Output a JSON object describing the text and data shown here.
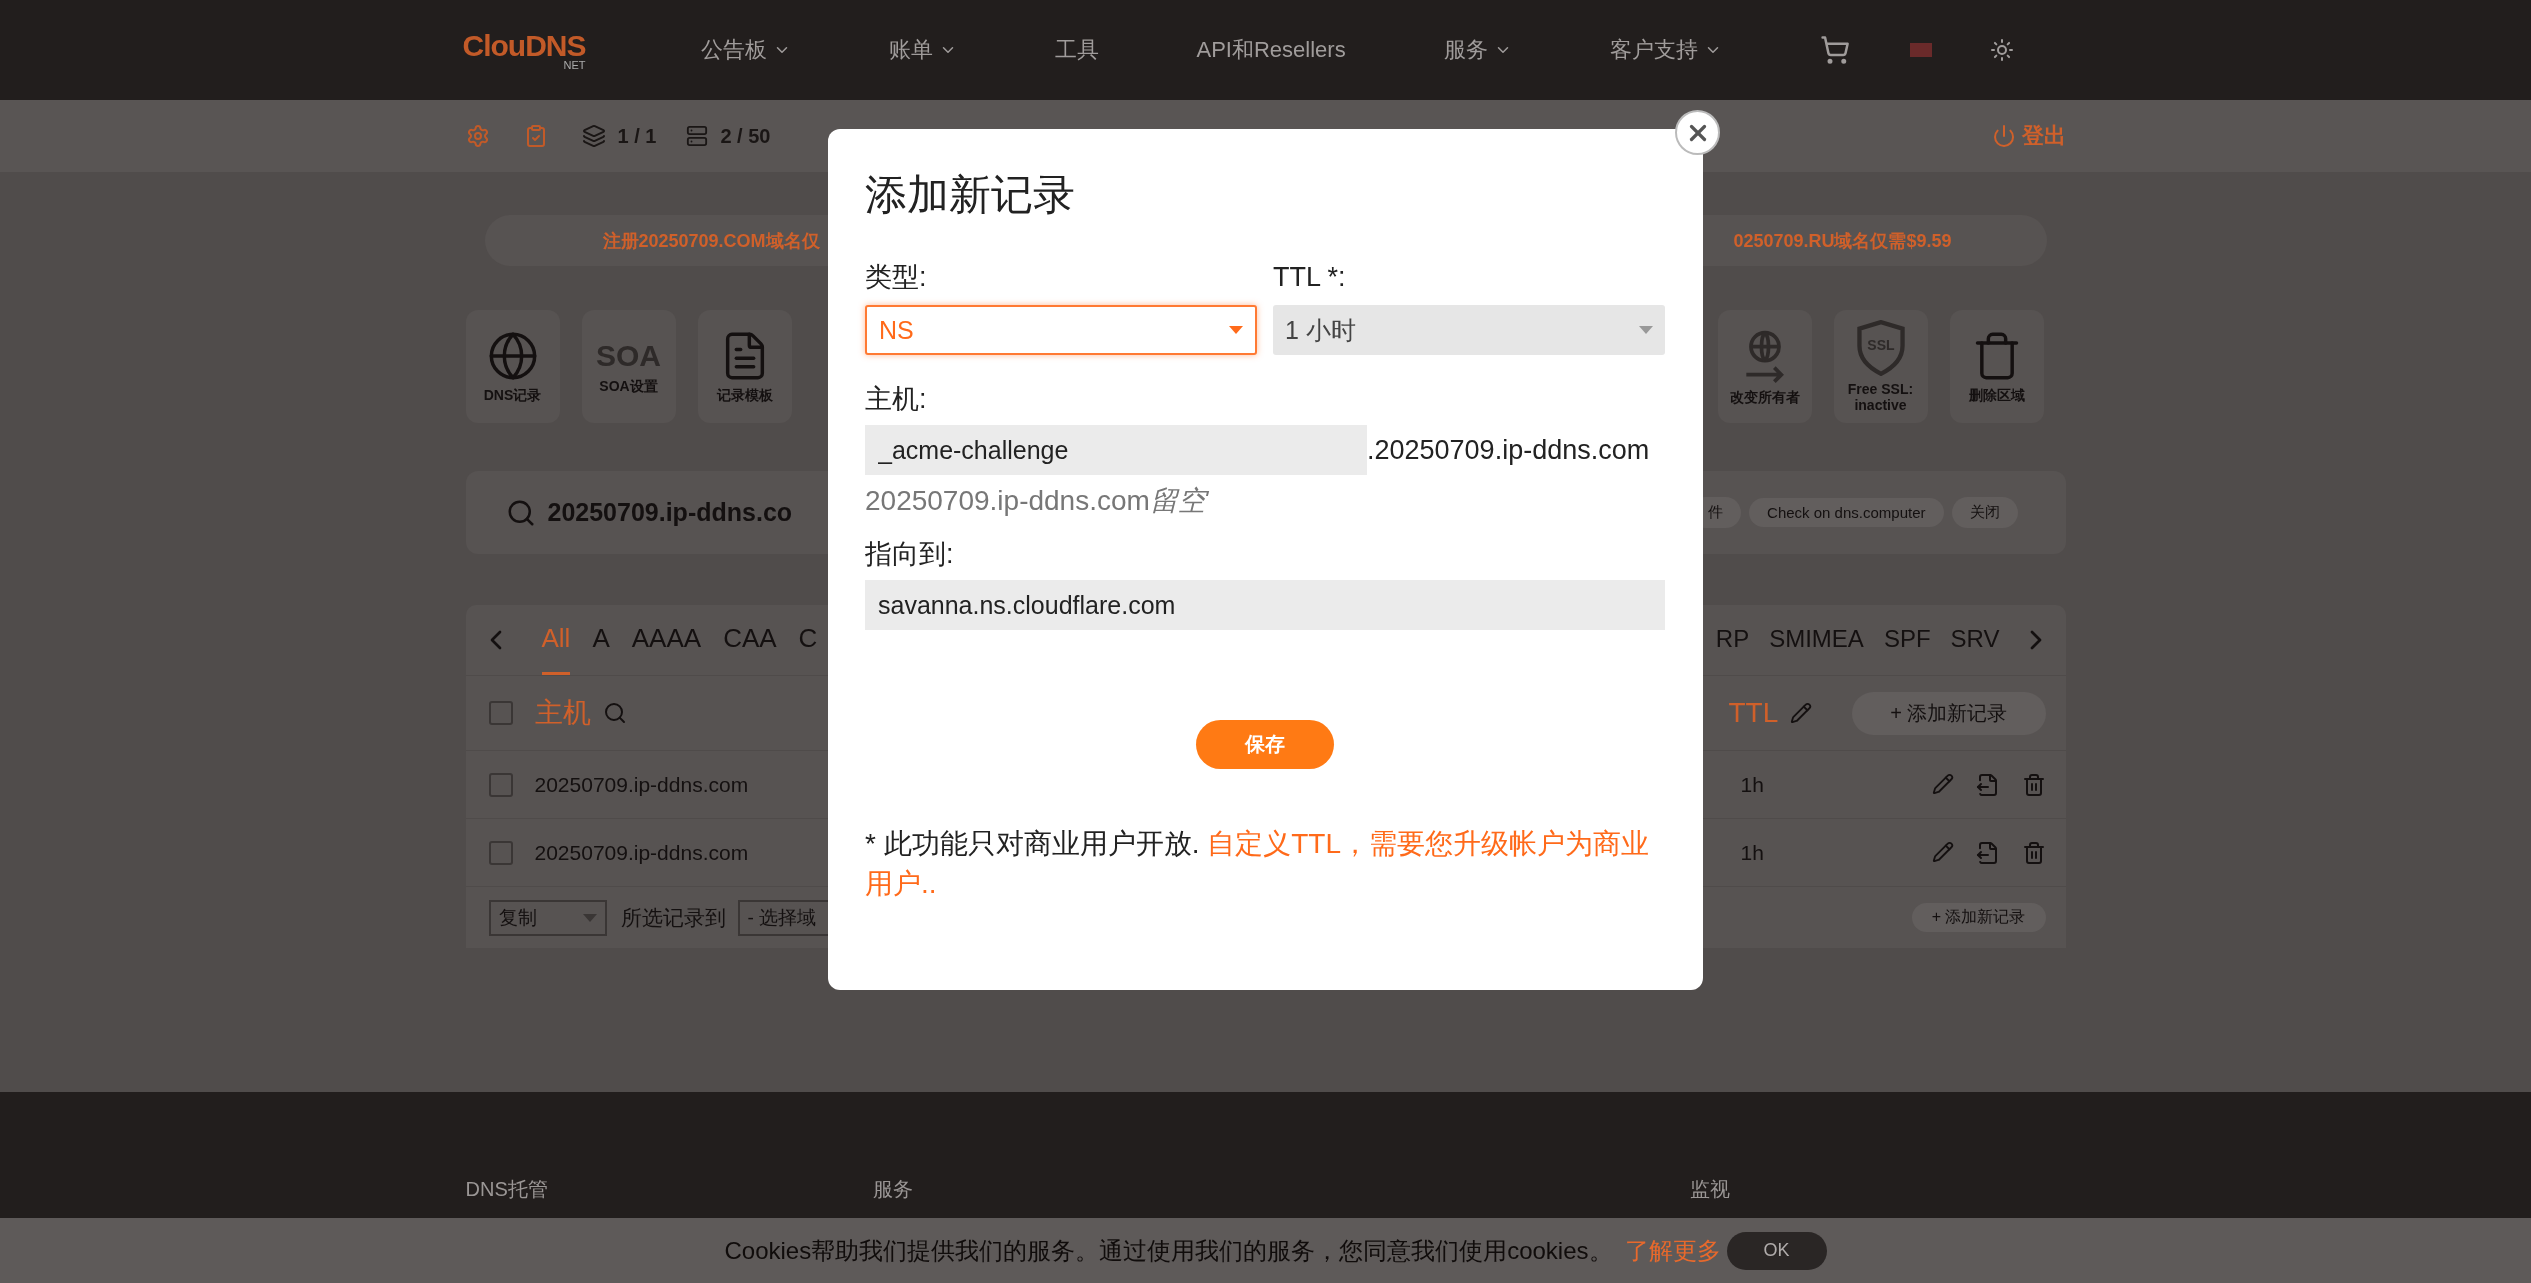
{
  "nav": {
    "logo": "ClouDNS",
    "logo_sub": "NET",
    "items": [
      {
        "label": "公告板",
        "dropdown": true
      },
      {
        "label": "账单",
        "dropdown": true
      },
      {
        "label": "工具",
        "dropdown": false
      },
      {
        "label": "API和Resellers",
        "dropdown": false
      },
      {
        "label": "服务",
        "dropdown": true
      },
      {
        "label": "客户支持",
        "dropdown": true
      }
    ]
  },
  "subbar": {
    "counters": [
      {
        "kind": "zones",
        "value": "1 / 1"
      },
      {
        "kind": "records",
        "value": "2 / 50"
      }
    ],
    "logout": "登出"
  },
  "banner": {
    "left": "注册20250709.COM域名仅",
    "right": "0250709.RU域名仅需$9.59"
  },
  "tools": [
    {
      "kind": "dns",
      "label": "DNS记录"
    },
    {
      "kind": "soa",
      "label": "SOA设置",
      "glyph": "SOA"
    },
    {
      "kind": "template",
      "label": "记录模板"
    },
    {
      "kind": "owner",
      "label": "改变所有者"
    },
    {
      "kind": "ssl",
      "label": "Free SSL: inactive",
      "glyph": "SSL"
    },
    {
      "kind": "delete",
      "label": "删除区域"
    }
  ],
  "search": {
    "domain": "20250709.ip-ddns.co",
    "chips": [
      "件",
      "Check on dns.computer",
      "关闭"
    ]
  },
  "record_tabs": {
    "left": [
      {
        "label": "All",
        "selected": true
      },
      {
        "label": "A",
        "selected": false
      },
      {
        "label": "AAAA",
        "selected": false
      },
      {
        "label": "CAA",
        "selected": false
      },
      {
        "label": "C",
        "selected": false
      }
    ],
    "right": [
      {
        "label": "RP",
        "selected": false
      },
      {
        "label": "SMIMEA",
        "selected": false
      },
      {
        "label": "SPF",
        "selected": false
      },
      {
        "label": "SRV",
        "selected": false
      }
    ]
  },
  "table": {
    "header_checked": false,
    "columns": [
      {
        "label": "主机"
      },
      {
        "label": "TTL"
      }
    ],
    "add_button": "+ 添加新记录",
    "rows": [
      {
        "host": "20250709.ip-ddns.com",
        "ttl": "1h",
        "checked": false
      },
      {
        "host": "20250709.ip-ddns.com",
        "ttl": "1h",
        "checked": false
      }
    ],
    "footer": {
      "action": "复制",
      "label": "所选记录到",
      "target": "- 选择域",
      "add_button": "+ 添加新记录"
    }
  },
  "footer": {
    "columns": [
      "DNS托管",
      "服务",
      "监视"
    ]
  },
  "cookie": {
    "text": "Cookies帮助我们提供我们的服务。通过使用我们的服务，您同意我们使用cookies。",
    "link": "了解更多",
    "button": "OK"
  },
  "dialog": {
    "title": "添加新记录",
    "type": {
      "label": "类型:",
      "value": "NS",
      "focused": true
    },
    "ttl": {
      "label": "TTL *:",
      "value": "1 小时",
      "disabled": true
    },
    "host": {
      "label": "主机:",
      "value": "_acme-challenge",
      "suffix": ".20250709.ip-ddns.com",
      "hint": "20250709.ip-ddns.com",
      "hint_em": "留空"
    },
    "points_to": {
      "label": "指向到:",
      "value": "savanna.ns.cloudflare.com"
    },
    "save": "保存",
    "note": {
      "text": "* 此功能只对商业用户开放.",
      "highlight": "自定义TTL，需要您升级帐户为商业用户.."
    }
  }
}
